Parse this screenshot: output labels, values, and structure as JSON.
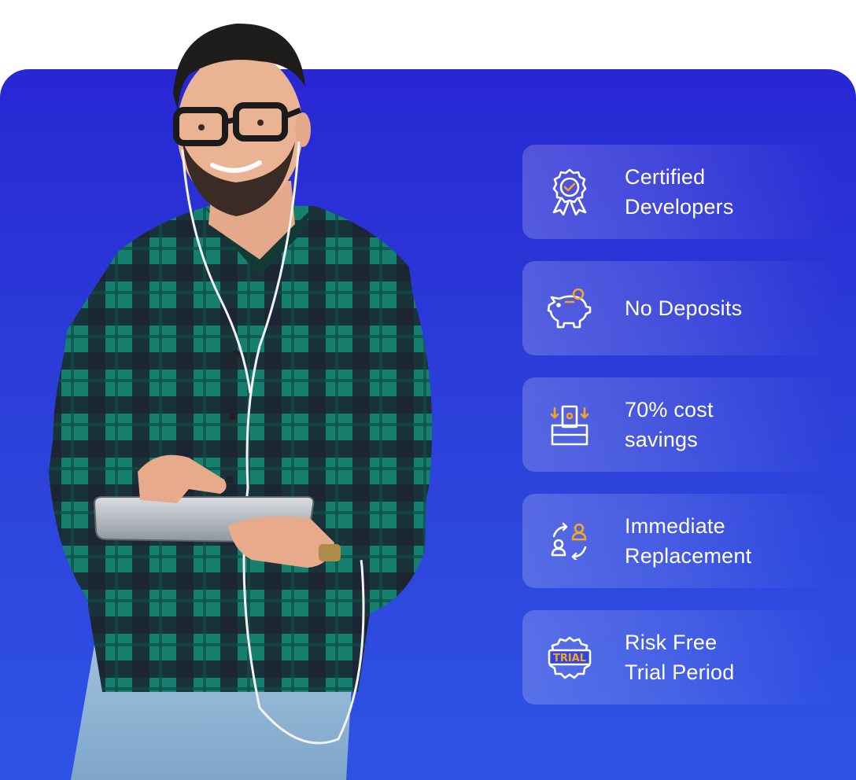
{
  "features": [
    {
      "icon": "award-badge-icon",
      "line1": "Certified",
      "line2": "Developers"
    },
    {
      "icon": "piggy-bank-icon",
      "line1": "No Deposits",
      "line2": ""
    },
    {
      "icon": "money-box-icon",
      "line1": "70% cost",
      "line2": "savings"
    },
    {
      "icon": "replace-person-icon",
      "line1": "Immediate",
      "line2": "Replacement"
    },
    {
      "icon": "trial-badge-icon",
      "line1": "Risk Free",
      "line2": "Trial Period",
      "badge_text": "TRIAL"
    }
  ],
  "colors": {
    "panel_top": "#2727d3",
    "panel_bottom": "#2f53e6",
    "icon_white": "#ffffff",
    "icon_accent": "#f5a623"
  }
}
